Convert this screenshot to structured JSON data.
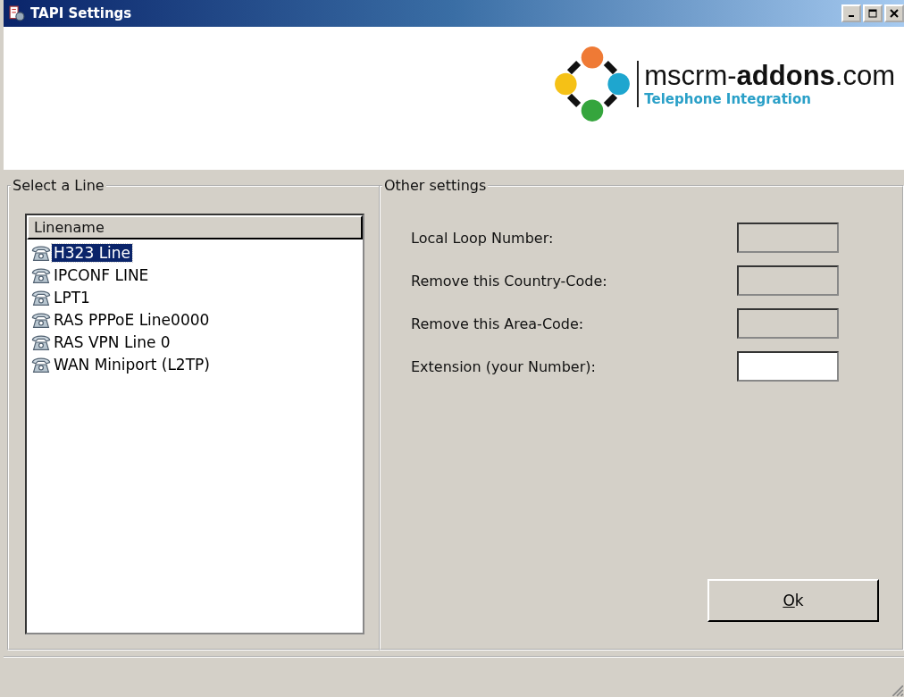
{
  "window": {
    "title": "TAPI Settings"
  },
  "logo": {
    "brand_prefix": "mscrm-",
    "brand_bold": "addons",
    "brand_suffix": ".com",
    "tagline": "Telephone Integration"
  },
  "line_group": {
    "title": "Select a Line",
    "column": "Linename",
    "lines": [
      {
        "name": "H323 Line",
        "selected": true
      },
      {
        "name": "IPCONF LINE",
        "selected": false
      },
      {
        "name": "LPT1",
        "selected": false
      },
      {
        "name": "RAS PPPoE Line0000",
        "selected": false
      },
      {
        "name": "RAS VPN Line 0",
        "selected": false
      },
      {
        "name": "WAN Miniport (L2TP)",
        "selected": false
      }
    ]
  },
  "settings_group": {
    "title": "Other settings",
    "fields": [
      {
        "label": "Local Loop Number:",
        "disabled": true
      },
      {
        "label": "Remove this Country-Code:",
        "disabled": true
      },
      {
        "label": "Remove this Area-Code:",
        "disabled": true
      },
      {
        "label": "Extension (your Number):",
        "disabled": false
      }
    ]
  },
  "buttons": [
    "Ok"
  ]
}
